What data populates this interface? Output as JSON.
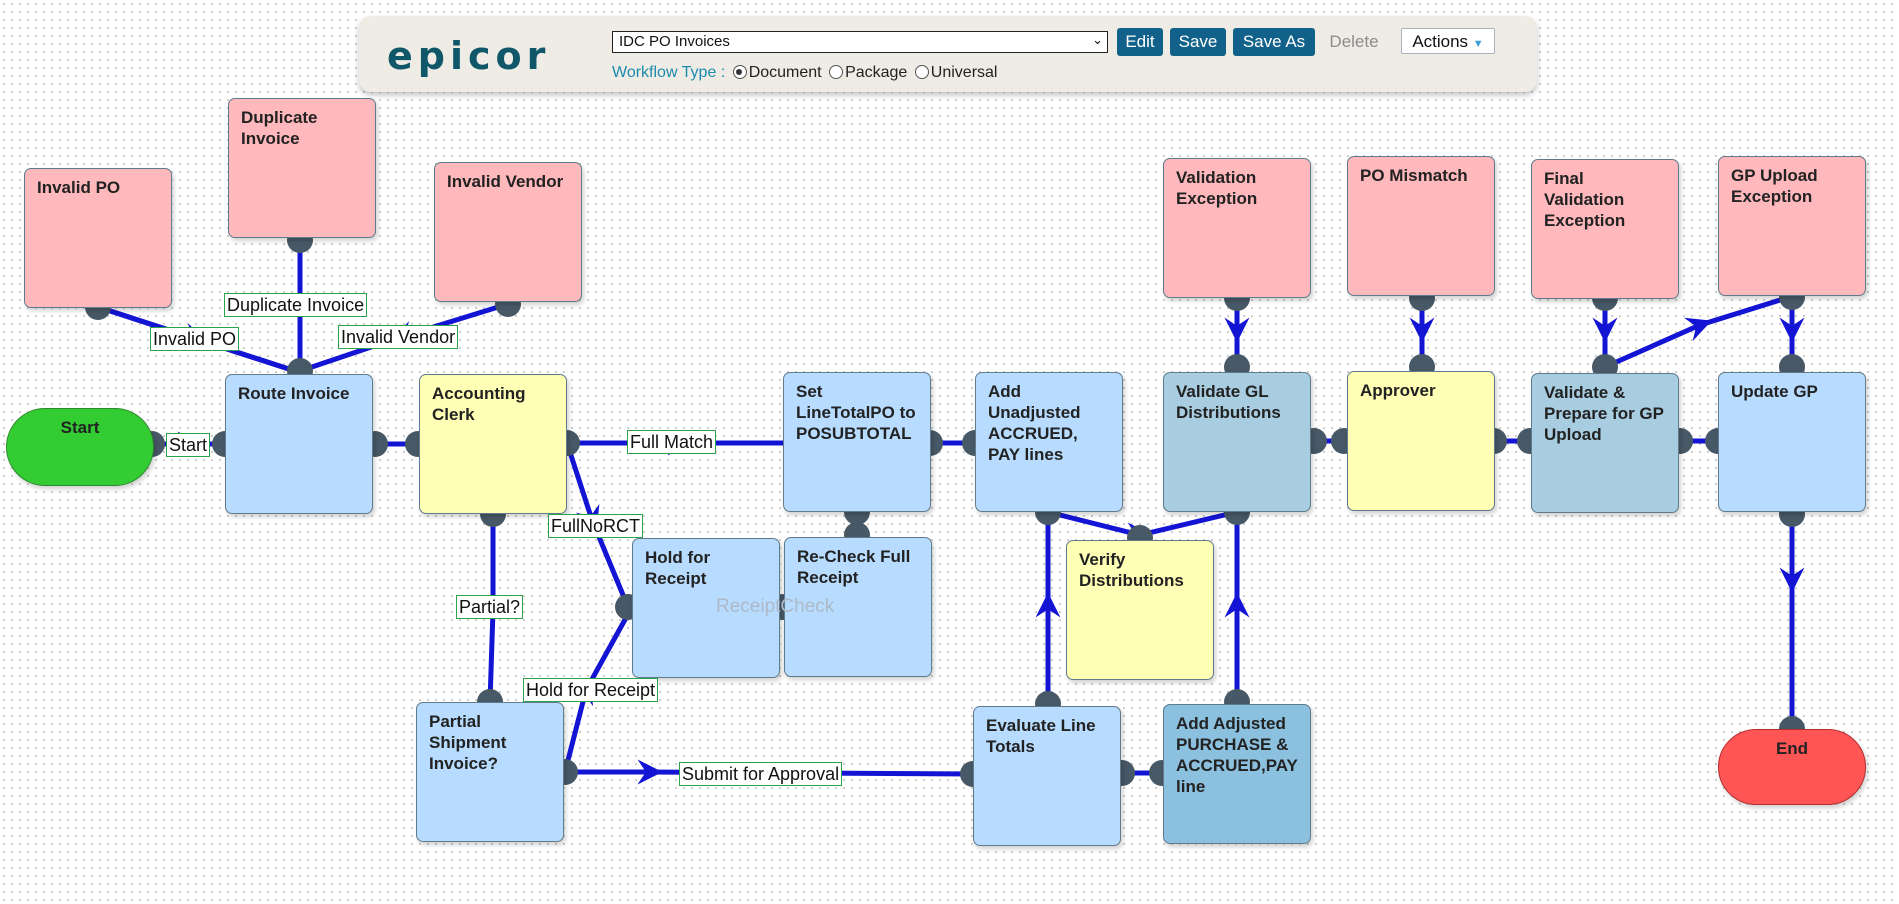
{
  "toolbar": {
    "logo": "epicor",
    "workflow_select": "IDC PO Invoices",
    "edit_label": "Edit",
    "save_label": "Save",
    "save_as_label": "Save As",
    "delete_label": "Delete",
    "actions_label": "Actions",
    "workflow_type_label": "Workflow Type :",
    "types": [
      "Document",
      "Package",
      "Universal"
    ],
    "selected_type": "Document"
  },
  "nodes": {
    "invalid_po": "Invalid PO",
    "duplicate_invoice": "Duplicate Invoice",
    "invalid_vendor": "Invalid Vendor",
    "start": "Start",
    "route_invoice": "Route Invoice",
    "accounting_clerk": "Accounting Clerk",
    "set_linetotal": "Set LineTotalPO to POSUBTOTAL",
    "add_unadjusted": "Add Unadjusted ACCRUED, PAY lines",
    "hold_for_receipt": "Hold for Receipt",
    "recheck_full_receipt": "Re-Check Full Receipt",
    "verify_distributions": "Verify Distributions",
    "partial_shipment": "Partial Shipment Invoice?",
    "evaluate_line_totals": "Evaluate Line Totals",
    "add_adjusted": "Add Adjusted PURCHASE & ACCRUED,PAY line",
    "validation_exception": "Validation Exception",
    "po_mismatch": "PO Mismatch",
    "final_validation_exception": "Final Validation Exception",
    "gp_upload_exception": "GP Upload Exception",
    "validate_gl": "Validate GL Distributions",
    "approver": "Approver",
    "validate_prepare": "Validate & Prepare for GP Upload",
    "update_gp": "Update GP",
    "end": "End"
  },
  "edge_labels": {
    "duplicate_invoice": "Duplicate Invoice",
    "invalid_po": "Invalid PO",
    "invalid_vendor": "Invalid Vendor",
    "start": "Start",
    "full_match": "Full Match",
    "full_no_rct": "FullNoRCT",
    "partial": "Partial?",
    "hold_for_receipt": "Hold for Receipt",
    "submit_for_approval": "Submit for Approval",
    "receipt_check": "ReceiptCheck"
  },
  "colors": {
    "edge": "#1414d4",
    "connector": "#475866",
    "exception_node": "#ffb8bc",
    "task_node": "#b7dcff",
    "user_node": "#ffffb6",
    "start_node": "#33cc33",
    "end_node": "#ff5555",
    "brand": "#0f5769"
  }
}
